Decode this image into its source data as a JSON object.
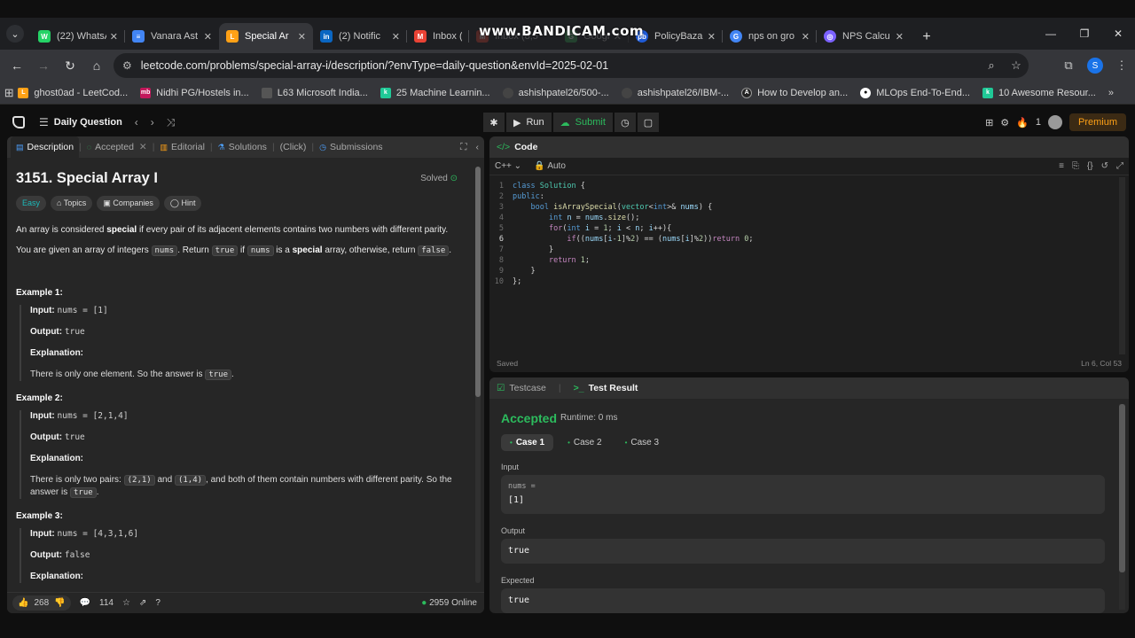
{
  "browser": {
    "tabs": [
      {
        "label": "(22) WhatsApp",
        "color": "#25d366",
        "glyph": "W"
      },
      {
        "label": "Vanara Ast",
        "color": "#4285f4",
        "glyph": "≡"
      },
      {
        "label": "Special Ar",
        "color": "#ffa116",
        "glyph": "L",
        "active": true
      },
      {
        "label": "(2) Notific",
        "color": "#0a66c2",
        "glyph": "in"
      },
      {
        "label": "Inbox (8,5",
        "color": "#ea4335",
        "glyph": "M"
      },
      {
        "label": "Inbox (8,5",
        "color": "#ea4335",
        "glyph": "M"
      },
      {
        "label": "Google Dr",
        "color": "#34a853",
        "glyph": "G"
      },
      {
        "label": "PolicyBaza",
        "color": "#1e5ad6",
        "glyph": "pb"
      },
      {
        "label": "nps on gro",
        "color": "#4285f4",
        "glyph": "G"
      },
      {
        "label": "NPS Calcu",
        "color": "#7b61ff",
        "glyph": "◎"
      }
    ],
    "watermark": "www.BANDICAM.com",
    "url": "leetcode.com/problems/special-array-i/description/?envType=daily-question&envId=2025-02-01",
    "profile_initial": "S",
    "bookmarks": [
      {
        "label": "ghost0ad - LeetCod...",
        "color": "#ffa116",
        "glyph": "L"
      },
      {
        "label": "Nidhi PG/Hostels in...",
        "color": "#c2185b",
        "glyph": "mb"
      },
      {
        "label": "L63 Microsoft India...",
        "color": "#555",
        "glyph": "L"
      },
      {
        "label": "25 Machine Learnin...",
        "color": "#20c997",
        "glyph": "k"
      },
      {
        "label": "ashishpatel26/500-...",
        "color": "#333",
        "glyph": "●"
      },
      {
        "label": "ashishpatel26/IBM-...",
        "color": "#333",
        "glyph": "●"
      },
      {
        "label": "How to Develop an...",
        "color": "#222",
        "glyph": "A"
      },
      {
        "label": "MLOps End-To-End...",
        "color": "#111",
        "glyph": "●●"
      },
      {
        "label": "10 Awesome Resour...",
        "color": "#20c997",
        "glyph": "k"
      }
    ]
  },
  "leetcode": {
    "daily_label": "Daily Question",
    "run_label": "Run",
    "submit_label": "Submit",
    "streak_count": "1",
    "premium_label": "Premium"
  },
  "left_panel": {
    "tabs": {
      "description": "Description",
      "accepted": "Accepted",
      "editorial": "Editorial",
      "solutions": "Solutions",
      "click": "(Click)",
      "submissions": "Submissions"
    },
    "title": "3151. Special Array I",
    "solved": "Solved",
    "chips": {
      "easy": "Easy",
      "topics": "Topics",
      "companies": "Companies",
      "hint": "Hint"
    },
    "p1": {
      "a": "An array is considered ",
      "b": "special",
      "c": " if every pair of its adjacent elements contains two numbers with different parity."
    },
    "p2": {
      "a": "You are given an array of integers ",
      "nums": "nums",
      "b": ". Return ",
      "t": "true",
      "c": " if ",
      "nums2": "nums",
      "d": " is a ",
      "e": "special",
      "f": " array, otherwise, return ",
      "false": "false",
      "g": "."
    },
    "labels": {
      "input": "Input:",
      "output": "Output:",
      "explanation": "Explanation:"
    },
    "ex1": {
      "heading": "Example 1:",
      "input": "nums = [1]",
      "output": "true",
      "exp_a": "There is only one element. So the answer is ",
      "exp_code": "true",
      "exp_b": "."
    },
    "ex2": {
      "heading": "Example 2:",
      "input": "nums = [2,1,4]",
      "output": "true",
      "exp_a": "There is only two pairs: ",
      "c1": "(2,1)",
      "exp_b": " and ",
      "c2": "(1,4)",
      "exp_c": ", and both of them contain numbers with different parity. So the answer is ",
      "c3": "true",
      "exp_d": "."
    },
    "ex3": {
      "heading": "Example 3:",
      "input": "nums = [4,3,1,6]",
      "output": "false",
      "explanation": "Explanation:"
    },
    "footer": {
      "likes": "268",
      "comments": "114",
      "online": "2959 Online"
    }
  },
  "code_panel": {
    "title": "Code",
    "language": "C++",
    "mode": "Auto",
    "saved": "Saved",
    "cursor": "Ln 6, Col 53",
    "line_numbers": [
      "1",
      "2",
      "3",
      "4",
      "5",
      "6",
      "7",
      "8",
      "9",
      "10"
    ]
  },
  "result_panel": {
    "testcase_tab": "Testcase",
    "result_tab": "Test Result",
    "status": "Accepted",
    "runtime": "Runtime: 0 ms",
    "cases": [
      "Case 1",
      "Case 2",
      "Case 3"
    ],
    "input_label": "Input",
    "var_name": "nums =",
    "input_value": "[1]",
    "output_label": "Output",
    "output_value": "true",
    "expected_label": "Expected",
    "expected_value": "true"
  },
  "colors": {
    "accent": "#ffa116",
    "success": "#2cbb5d",
    "easy": "#1cbaba"
  }
}
